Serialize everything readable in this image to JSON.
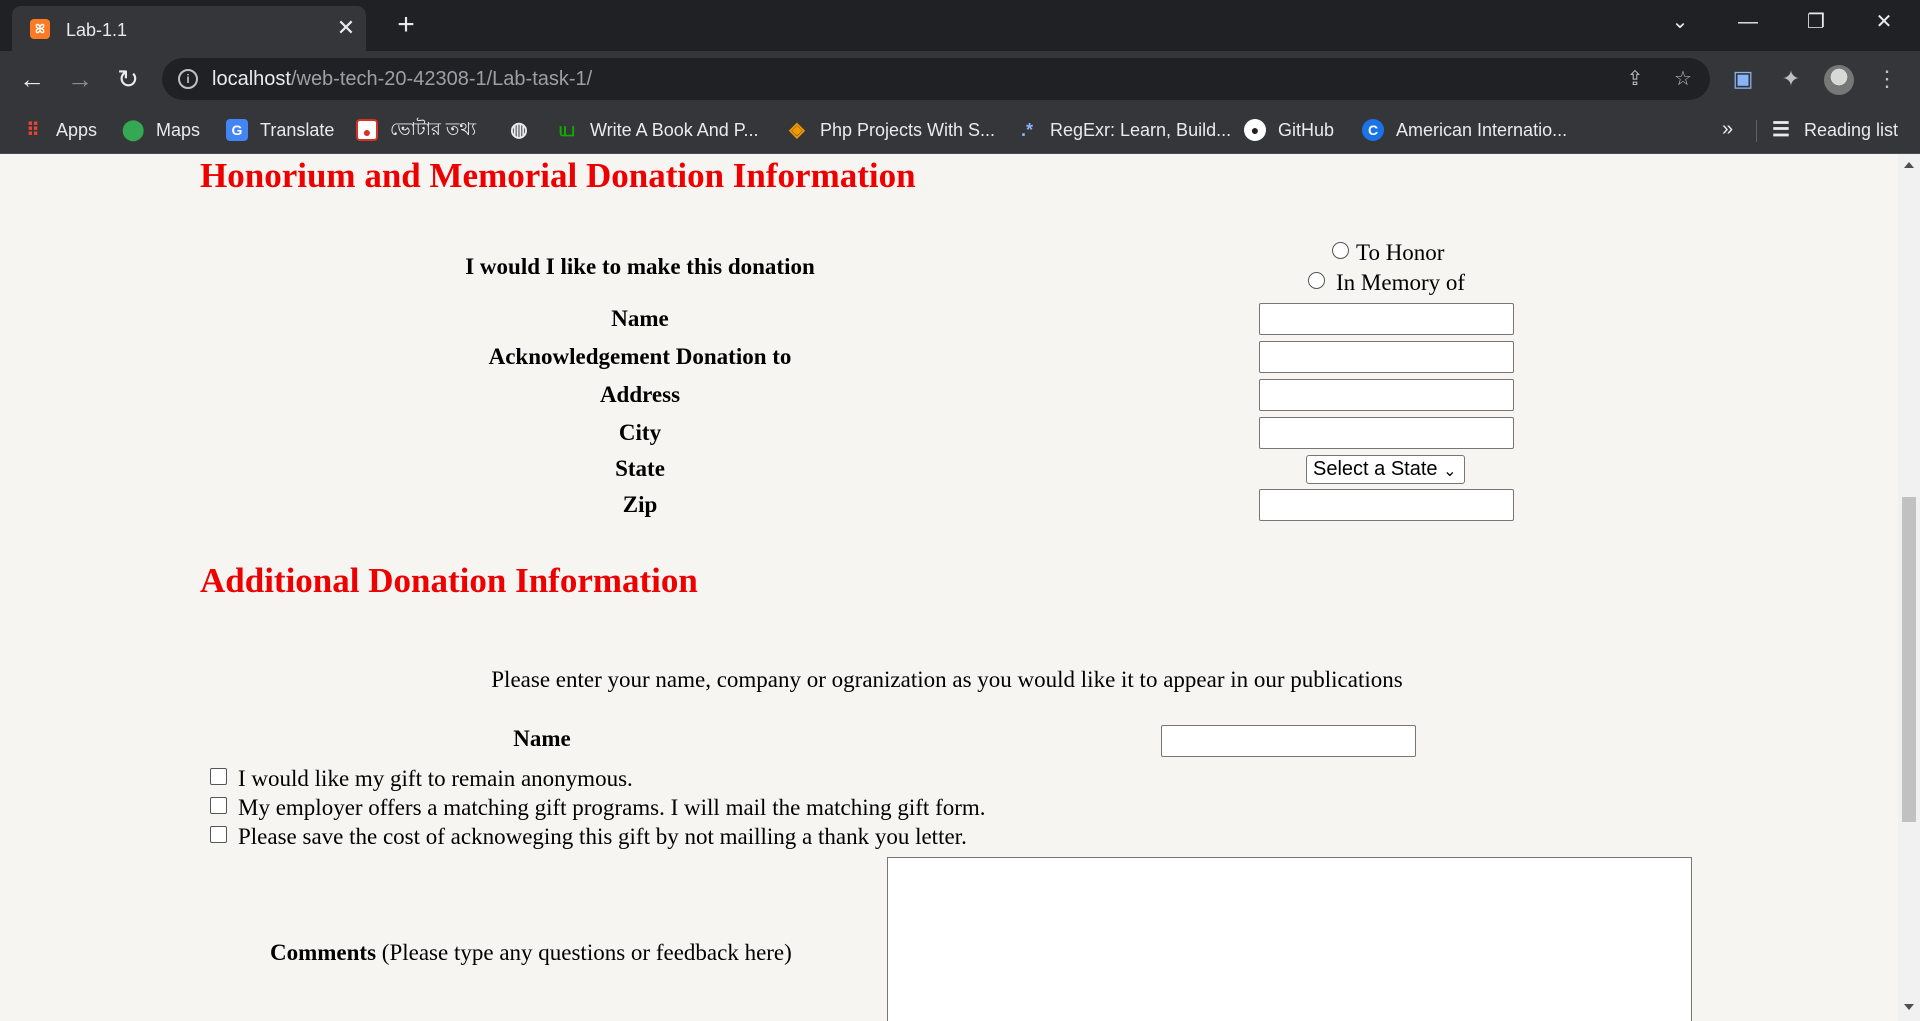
{
  "browser": {
    "tab_title": "Lab-1.1",
    "tab_favicon_text": "ꕤ",
    "url_host": "localhost",
    "url_path": "/web-tech-20-42308-1/Lab-task-1/",
    "bookmarks": [
      {
        "label": "Apps",
        "icon": "apps-grid-icon",
        "color": "#ea4335"
      },
      {
        "label": "Maps",
        "icon": "maps-pin-icon",
        "color": "#34a853"
      },
      {
        "label": "Translate",
        "icon": "translate-icon",
        "color": "#4285f4"
      },
      {
        "label": "ভোটার তথ্য",
        "icon": "election-logo-icon",
        "color": "#d93025"
      },
      {
        "label": "",
        "icon": "globe-icon",
        "color": "#5f6368"
      },
      {
        "label": "Write A Book And P...",
        "icon": "upwork-icon",
        "color": "#14a800"
      },
      {
        "label": "Php Projects With S...",
        "icon": "diamond-logo-icon",
        "color": "#f29900"
      },
      {
        "label": "RegExr: Learn, Build...",
        "icon": "regexr-icon",
        "color": "#4285f4"
      },
      {
        "label": "GitHub",
        "icon": "github-icon",
        "color": "#ffffff"
      },
      {
        "label": "American Internatio...",
        "icon": "aiub-logo-icon",
        "color": "#1a73e8"
      }
    ],
    "more_bookmarks": "»",
    "reading_list": "Reading list"
  },
  "honor": {
    "heading": "Honorium and Memorial Donation Information",
    "donation_question": "I would I like to make this donation",
    "radio_options": [
      "To Honor",
      "In Memory of"
    ],
    "fields": [
      "Name",
      "Acknowledgement Donation to",
      "Address",
      "City",
      "State",
      "Zip"
    ],
    "state_select": "Select a State"
  },
  "additional": {
    "heading": "Additional Donation Information",
    "instructions": "Please enter your name, company or ogranization as you would like it to appear in our publications",
    "name_label": "Name",
    "checkboxes": [
      "I would like my gift to remain anonymous.",
      "My employer offers a matching gift programs. I will mail the matching gift form.",
      "Please save the cost of acknoweging this gift by not mailling a thank you letter."
    ],
    "comments_label": "Comments",
    "comments_hint": "(Please type any questions or feedback here)"
  },
  "colors": {
    "heading": "#ee0000",
    "page_bg": "#f6f5f2",
    "chrome_dark": "#202124",
    "chrome": "#35363a"
  }
}
